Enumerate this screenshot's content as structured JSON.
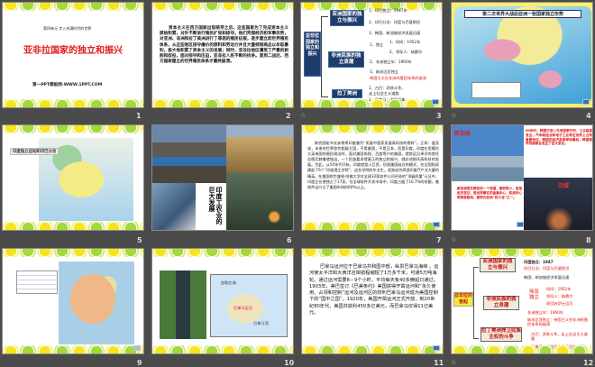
{
  "slides": [
    {
      "number": "1",
      "subtitle": "第四单元 步入充满时代的世界",
      "title": "亚非拉国家的独立和振兴",
      "footer": "第一PPT模板网-WWW.1PPT.COM"
    },
    {
      "number": "2",
      "body": "资本主义在西方国家出现萌芽之后，这些国家为了完成资本主义原始积累，对外不断进行殖民扩张和掠夺。他们凭借经济和军事优势，对亚洲、非洲和拉丁美洲进行了罪恶的殖民征服，逐步建立起世界殖民体系，从这些地区掠夺廉价的原料和劳动力并且大量倾销商品以牟取暴利，极大地积累了资本主义的发展；同时，亚非拉地区遭受了严重的剥削和奴役，面对掠夺和压迫，亚非拉人民不断的抗争。直到二战后，西方国家建立的世界殖民体系才最终崩溃。"
    },
    {
      "number": "3",
      "root": "亚非拉国家的独立和振兴",
      "asia": "亚洲国家的独立与振兴",
      "africa": "非洲民族的独立浪潮",
      "latam": "拉丁美洲",
      "asia_items": [
        "1、印巴独立：1947年",
        "2、印巴分治：印度与巴基斯坦",
        "3、韩国、新加坡经济发展迅速"
      ],
      "africa_items": [
        "1、独立",
        "1、时间：1952年",
        "2、领导人：纳赛尔",
        "2、非洲独立年：1960年",
        "3、纳米比亚独立"
      ],
      "africa_red": "帝国主义在非洲的殖民体系的崩溃",
      "latam_items": [
        "1、古巴：武装斗争，走上社会主义道路",
        "2、巴拿马：收回巴拿马运河的主权"
      ]
    },
    {
      "number": "4",
      "title": "第二次世界大战后亚洲一些国家独立形势"
    },
    {
      "number": "5",
      "title": "印度独立运动和印巴分治"
    },
    {
      "number": "6",
      "caption": "印度工农业的巨大发展"
    },
    {
      "number": "7",
      "body": "联合国秘书长安南将印度誉为“发展中国家发展高科技的榜样”。正如：盖茨说，未来的世界软件超级大国，不是美国，不是日本，而是印度。印度在用模仿大英帝国的殖民政治时，面对美国电视，百度等兴的美国，就其远见卓识的首任总理尼赫鲁就指出，一个民族要求得真正的独立和振兴，就必须依托高科技的发展。为此，从50年代开始，印度就投入巨资，仿照美国硅谷的模式，在全国陆续建起了6个“印度理工学院”，这些学院的毕业生，逐渐成为缔造印度IT产业大厦的精英。在美国的华盛顿·哈佛大学对全球32家软件公司评选的“顶级质量”认证中，印度企业便独占了17家。在全球软件开发市场中，印度占据了16.7%的份额，美软件出口占了美国市场的60%以上。"
    },
    {
      "number": "8",
      "label_sg": "新加坡",
      "label_kr": "汉城",
      "text_top": "60年代，韩国已进入先进国家行列，工业高度发达，汽车制造业和电子工业等在世界上占有重要地位，韩国的经济发展举世瞩目，韩国城市的面貌也发生了巨大变化。",
      "text_bottom": "新加坡是东南亚的一个岛国，面积很小，但是经济发达，是世界著名的金融中心、航运中心和旅游胜地，被称为亚洲“四小龙”之一。"
    },
    {
      "number": "9"
    },
    {
      "number": "10",
      "map_label_1": "加勒比海",
      "map_label_2": "巴拿马运河",
      "map_label_3": "巴拿马湾"
    },
    {
      "number": "11",
      "body": "巴拿马运河位于巴拿马共和国中部，纵贯巴拿马海峡 。运河使太平洋和大西洋召岸航程缩短了1万多千米，可通5万吨海轮。通过运河需要8－9个小时，平均每天有40多艘船只通过。1903年，美巴签订《巴美条约》美国获得开凿运河和“永久使用、占领和控制”运河及运河区的权利巴拿马运河成为美国控制下的“国中之国”。1920年，美国开凿运河正式开放，到20世纪80年代，美国共获利450多亿美元，而巴拿马仅得11亿美元。"
    },
    {
      "number": "12",
      "root": "亚非拉的奋起",
      "asia": "亚洲国家的独立与振兴",
      "africa": "非洲民族的独立浪潮",
      "latam": "拉丁美洲捍卫民族主权的斗争",
      "asia_items": [
        "印度独立：1947",
        "印巴分治：印度与巴基斯坦",
        "韩国、新加坡经济发展迅速"
      ],
      "africa_sub": "埃及独立",
      "africa_items": [
        "时间：1952年",
        "领导人：纳赛尔",
        "收回苏伊士运河",
        "非洲独立年：1960年",
        "纳米比亚独立：帝国主义在非洲的殖民体系的崩溃"
      ],
      "latam_items": [
        "古巴：武装斗争，走上社会主义道路",
        "巴拿马：收回巴拿马运河的主权"
      ]
    }
  ],
  "animation_marker": "☆"
}
